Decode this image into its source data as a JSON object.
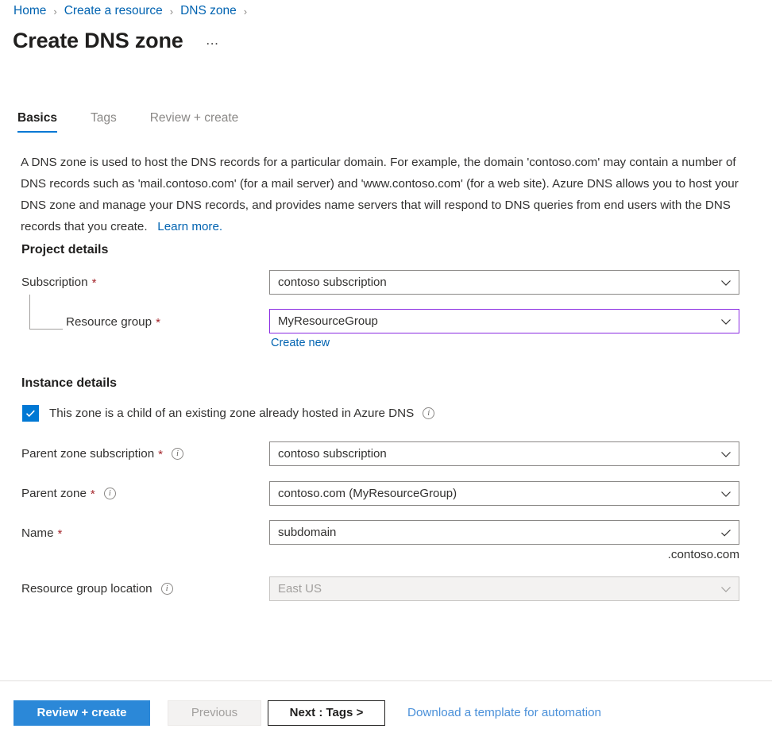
{
  "breadcrumb": {
    "items": [
      {
        "label": "Home"
      },
      {
        "label": "Create a resource"
      },
      {
        "label": "DNS zone"
      }
    ],
    "separator": "›"
  },
  "header": {
    "title": "Create DNS zone",
    "more_label": "…"
  },
  "tabs": [
    {
      "label": "Basics",
      "active": true
    },
    {
      "label": "Tags",
      "active": false
    },
    {
      "label": "Review + create",
      "active": false
    }
  ],
  "description": {
    "text": "A DNS zone is used to host the DNS records for a particular domain. For example, the domain 'contoso.com' may contain a number of DNS records such as 'mail.contoso.com' (for a mail server) and 'www.contoso.com' (for a web site). Azure DNS allows you to host your DNS zone and manage your DNS records, and provides name servers that will respond to DNS queries from end users with the DNS records that you create.",
    "learn_more": "Learn more."
  },
  "project_details": {
    "heading": "Project details",
    "subscription": {
      "label": "Subscription",
      "required": "*",
      "value": "contoso subscription"
    },
    "resource_group": {
      "label": "Resource group",
      "required": "*",
      "value": "MyResourceGroup",
      "create_new": "Create new"
    }
  },
  "instance_details": {
    "heading": "Instance details",
    "child_zone_checkbox": {
      "label": "This zone is a child of an existing zone already hosted in Azure DNS",
      "checked": true
    },
    "parent_zone_subscription": {
      "label": "Parent zone subscription",
      "required": "*",
      "value": "contoso subscription"
    },
    "parent_zone": {
      "label": "Parent zone",
      "required": "*",
      "value": "contoso.com (MyResourceGroup)"
    },
    "name": {
      "label": "Name",
      "required": "*",
      "value": "subdomain",
      "suffix": ".contoso.com"
    },
    "resource_group_location": {
      "label": "Resource group location",
      "value": "East US",
      "disabled": true
    }
  },
  "footer": {
    "review_create": "Review + create",
    "previous": "Previous",
    "next": "Next : Tags >",
    "download_template": "Download a template for automation"
  },
  "colors": {
    "accent": "#0078d4",
    "primary_button": "#2b88d8",
    "link": "#0063b1",
    "required_star": "#a4262c",
    "focus_border": "#8a2be2",
    "border": "#8a8886"
  }
}
